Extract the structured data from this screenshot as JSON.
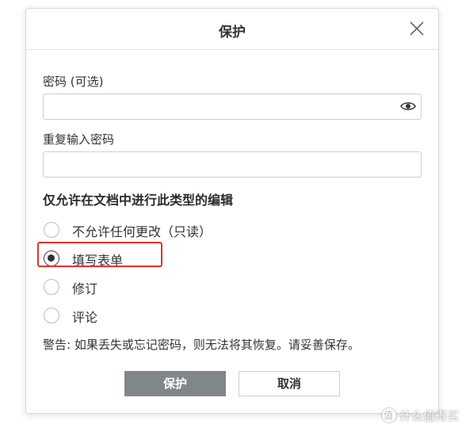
{
  "dialog": {
    "title": "保护",
    "close_icon": "close-icon"
  },
  "password": {
    "label": "密码 (可选)",
    "value": "",
    "toggle_icon": "eye-icon"
  },
  "confirm_password": {
    "label": "重复输入密码",
    "value": ""
  },
  "restriction": {
    "title": "仅允许在文档中进行此类型的编辑",
    "options": [
      {
        "label": "不允许任何更改（只读）",
        "selected": false
      },
      {
        "label": "填写表单",
        "selected": true
      },
      {
        "label": "修订",
        "selected": false
      },
      {
        "label": "评论",
        "selected": false
      }
    ]
  },
  "warning": "警告: 如果丢失或忘记密码，则无法将其恢复。请妥善保存。",
  "buttons": {
    "ok": "保护",
    "cancel": "取消"
  },
  "annotation": {
    "highlight_color": "#e0342c"
  },
  "watermark": {
    "text": "什么值得买"
  },
  "colors": {
    "primary_button": "#7f878a",
    "border": "#cfcfcf"
  }
}
